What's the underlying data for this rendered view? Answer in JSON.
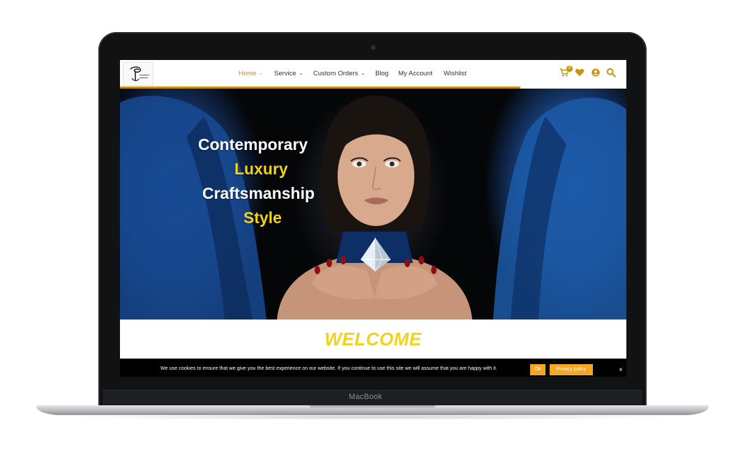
{
  "device": {
    "brand_label": "MacBook"
  },
  "header": {
    "logo_icon": "seal-logo-icon",
    "scroll_progress": 0.79,
    "nav": [
      {
        "label": "Home",
        "has_dropdown": true,
        "active": true
      },
      {
        "label": "Service",
        "has_dropdown": true
      },
      {
        "label": "Custom Orders",
        "has_dropdown": true
      },
      {
        "label": "Blog"
      },
      {
        "label": "My Account"
      },
      {
        "label": "Wishlist"
      }
    ],
    "icons": {
      "cart": "cart-icon",
      "cart_count": "0",
      "wishlist": "heart-icon",
      "account": "user-icon",
      "search": "search-icon"
    },
    "accent_color": "#c8920b"
  },
  "hero": {
    "lines": [
      {
        "text": "Contemporary",
        "color": "#ffffff"
      },
      {
        "text": "Luxury",
        "color": "#f2d21b"
      },
      {
        "text": "Craftsmanship",
        "color": "#ffffff"
      },
      {
        "text": "Style",
        "color": "#f2d21b"
      }
    ]
  },
  "welcome": {
    "title": "WELCOME",
    "color": "#f2d21b"
  },
  "cookie_bar": {
    "message": "We use cookies to ensure that we give you the best experience on our website. If you continue to use this site we will assume that you are happy with it.",
    "ok_label": "Ok",
    "privacy_label": "Privacy policy",
    "close_label": "×",
    "button_color": "#f5a623"
  }
}
